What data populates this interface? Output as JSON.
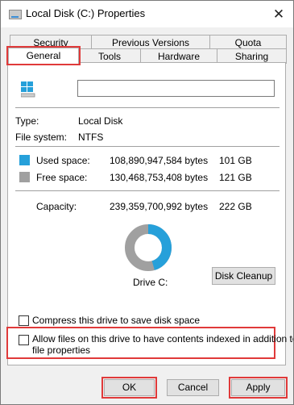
{
  "window": {
    "title": "Local Disk (C:) Properties",
    "close_symbol": "✕"
  },
  "tabs": {
    "row1": [
      "Security",
      "Previous Versions",
      "Quota"
    ],
    "row2": [
      "General",
      "Tools",
      "Hardware",
      "Sharing"
    ],
    "active": "General"
  },
  "general": {
    "name_value": "",
    "type_label": "Type:",
    "type_value": "Local Disk",
    "fs_label": "File system:",
    "fs_value": "NTFS",
    "used_label": "Used space:",
    "used_bytes": "108,890,947,584 bytes",
    "used_gb": "101 GB",
    "free_label": "Free space:",
    "free_bytes": "130,468,753,408 bytes",
    "free_gb": "121 GB",
    "capacity_label": "Capacity:",
    "capacity_bytes": "239,359,700,992 bytes",
    "capacity_gb": "222 GB",
    "drive_label": "Drive C:",
    "cleanup_label": "Disk Cleanup",
    "compress_label": "Compress this drive to save disk space",
    "compress_checked": false,
    "index_label_line1": "Allow files on this drive to have contents indexed in addition to",
    "index_label_line2": "file properties",
    "index_checked": false
  },
  "usage": {
    "used_fraction": 0.455,
    "used_color": "#26a0da",
    "free_color": "#a0a0a0"
  },
  "buttons": {
    "ok": "OK",
    "cancel": "Cancel",
    "apply": "Apply"
  },
  "highlight_color": "#e03a3a"
}
